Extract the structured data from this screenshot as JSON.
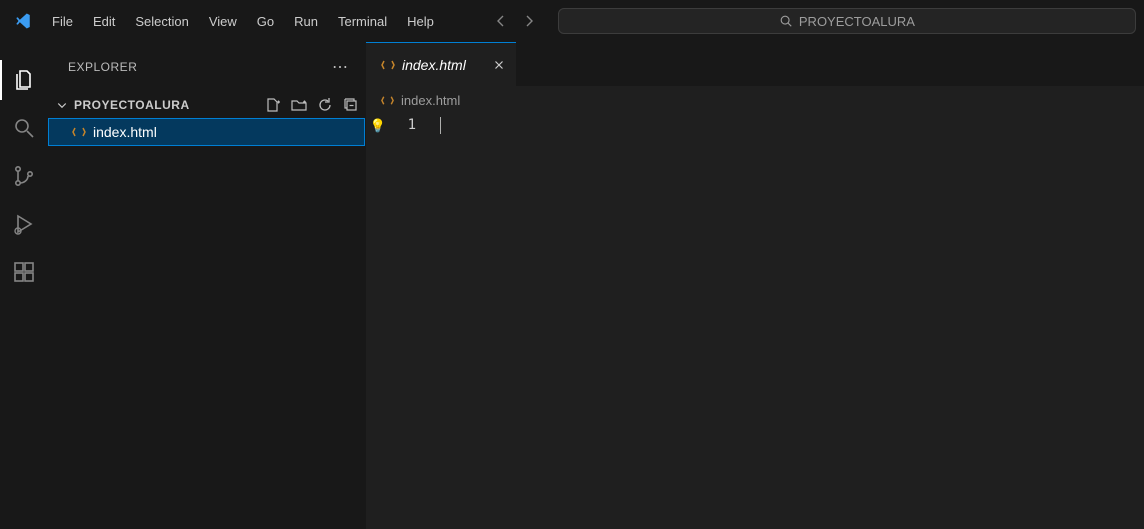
{
  "menubar": {
    "file": "File",
    "edit": "Edit",
    "selection": "Selection",
    "view": "View",
    "go": "Go",
    "run": "Run",
    "terminal": "Terminal",
    "help": "Help"
  },
  "command_center": {
    "label": "PROYECTOALURA"
  },
  "sidebar": {
    "title": "EXPLORER",
    "folder_name": "PROYECTOALURA",
    "tree": {
      "item0": "index.html"
    }
  },
  "tabs": {
    "tab0": "index.html"
  },
  "breadcrumb": {
    "item0": "index.html"
  },
  "editor": {
    "line1_number": "1",
    "line1_content": ""
  }
}
